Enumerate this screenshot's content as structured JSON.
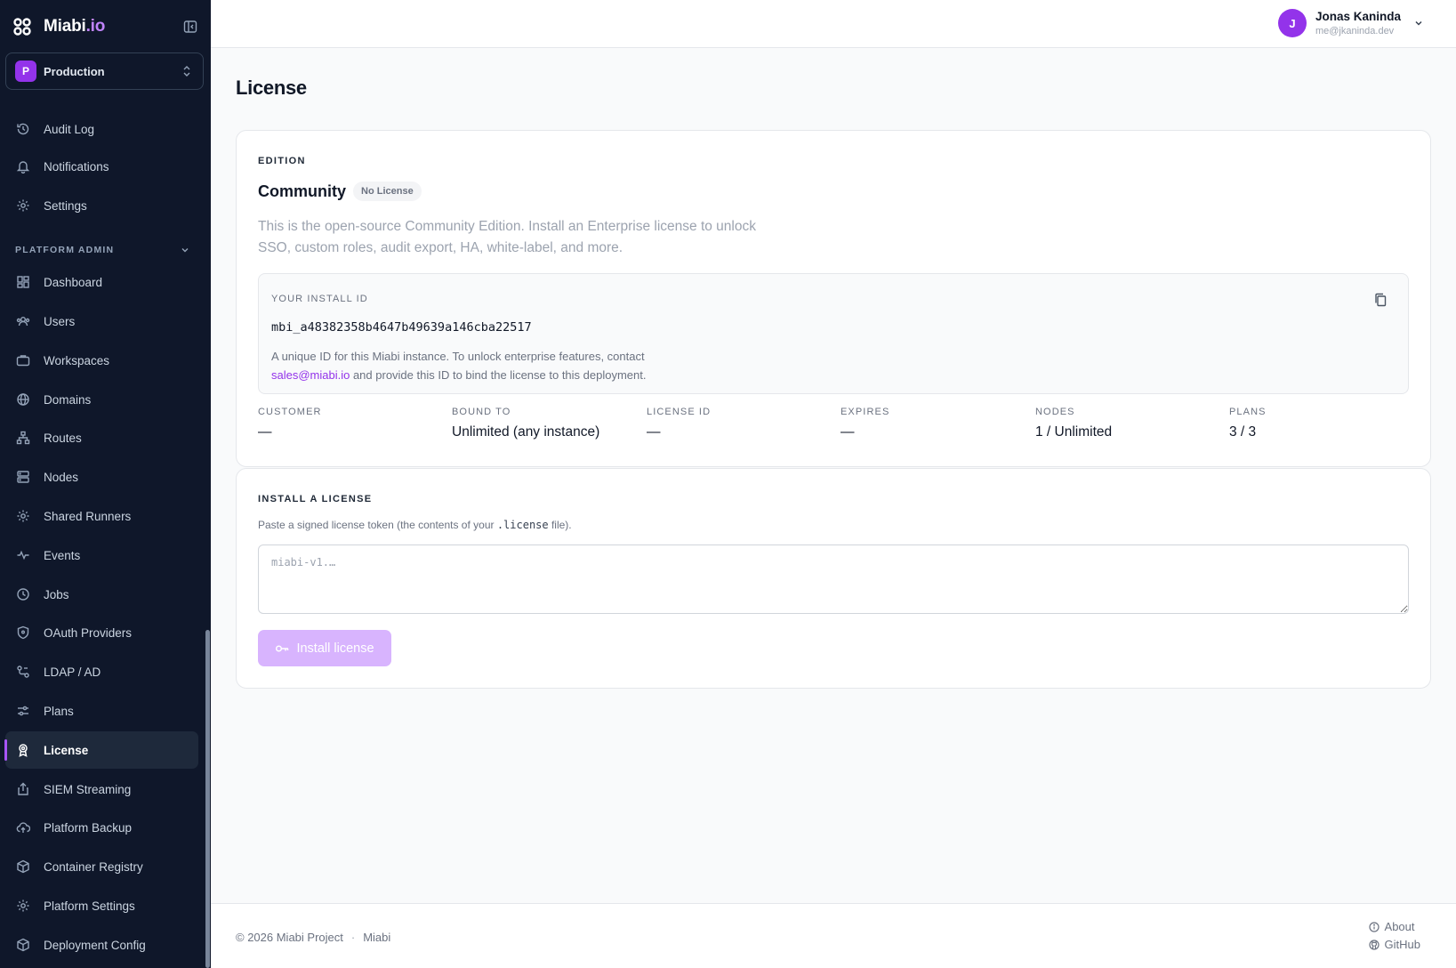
{
  "sidebar": {
    "brand": {
      "name": "Miabi",
      "suffix": ".io"
    },
    "workspace": {
      "badge": "P",
      "name": "Production"
    },
    "top_items": [
      {
        "label": "Audit Log",
        "icon": "history-icon"
      },
      {
        "label": "Notifications",
        "icon": "bell-icon"
      },
      {
        "label": "Settings",
        "icon": "gear-icon"
      }
    ],
    "section_title": "PLATFORM ADMIN",
    "admin_items": [
      {
        "label": "Dashboard",
        "icon": "dashboard-icon"
      },
      {
        "label": "Users",
        "icon": "users-icon"
      },
      {
        "label": "Workspaces",
        "icon": "briefcase-icon"
      },
      {
        "label": "Domains",
        "icon": "globe-icon"
      },
      {
        "label": "Routes",
        "icon": "routes-icon"
      },
      {
        "label": "Nodes",
        "icon": "server-icon"
      },
      {
        "label": "Shared Runners",
        "icon": "gear-icon"
      },
      {
        "label": "Events",
        "icon": "activity-icon"
      },
      {
        "label": "Jobs",
        "icon": "clock-icon"
      },
      {
        "label": "OAuth Providers",
        "icon": "shield-icon"
      },
      {
        "label": "LDAP / AD",
        "icon": "network-icon"
      },
      {
        "label": "Plans",
        "icon": "sliders-icon"
      },
      {
        "label": "License",
        "icon": "award-icon",
        "active": true
      },
      {
        "label": "SIEM Streaming",
        "icon": "share-icon"
      },
      {
        "label": "Platform Backup",
        "icon": "cloud-upload-icon"
      },
      {
        "label": "Container Registry",
        "icon": "box-icon"
      },
      {
        "label": "Platform Settings",
        "icon": "gear-icon"
      },
      {
        "label": "Deployment Config",
        "icon": "box-icon"
      }
    ]
  },
  "header": {
    "user": {
      "initial": "J",
      "name": "Jonas Kaninda",
      "email": "me@jkaninda.dev"
    }
  },
  "page": {
    "title": "License"
  },
  "edition_card": {
    "eyebrow": "EDITION",
    "edition": "Community",
    "badge": "No License",
    "description": "This is the open-source Community Edition. Install an Enterprise license to unlock SSO, custom roles, audit export, HA, white-label, and more.",
    "install_id_label": "YOUR INSTALL ID",
    "install_id": "mbi_a48382358b4647b49639a146cba22517",
    "install_help_before": "A unique ID for this Miabi instance. To unlock enterprise features, contact",
    "install_help_link": "sales@miabi.io",
    "install_help_after": " and provide this ID to bind the license to this deployment.",
    "meta": [
      {
        "label": "CUSTOMER",
        "value": "—"
      },
      {
        "label": "BOUND TO",
        "value": "Unlimited (any instance)"
      },
      {
        "label": "LICENSE ID",
        "value": "—"
      },
      {
        "label": "EXPIRES",
        "value": "—"
      },
      {
        "label": "NODES",
        "value": "1 / Unlimited"
      },
      {
        "label": "PLANS",
        "value": "3 / 3"
      }
    ]
  },
  "install_card": {
    "eyebrow": "INSTALL A LICENSE",
    "hint_before": "Paste a signed license token (the contents of your ",
    "hint_code": ".license",
    "hint_after": " file).",
    "placeholder": "miabi-v1.…",
    "button_label": "Install license"
  },
  "footer": {
    "copyright": "© 2026 Miabi Project",
    "separator": "·",
    "project": "Miabi",
    "about": "About",
    "github": "GitHub"
  },
  "colors": {
    "sidebar_bg": "#0f172a",
    "accent": "#9333ea",
    "accent_light": "#d8b4fe"
  }
}
